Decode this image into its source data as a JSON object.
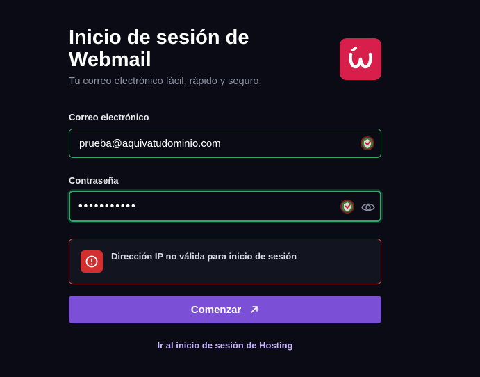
{
  "header": {
    "title": "Inicio de sesión de Webmail",
    "subtitle": "Tu correo electrónico fácil, rápido y seguro."
  },
  "email": {
    "label": "Correo electrónico",
    "value": "prueba@aquivatudominio.com"
  },
  "password": {
    "label": "Contraseña",
    "value": "•••••••••••"
  },
  "alert": {
    "message": "Dirección IP no válida para inicio de sesión"
  },
  "submit": {
    "label": "Comenzar"
  },
  "hosting_link": {
    "label": "Ir al inicio de sesión de Hosting"
  },
  "colors": {
    "background": "#0a0b14",
    "brand": "#d81f4b",
    "primary": "#7b4fd6",
    "success_border": "#2ea86a",
    "error_border": "#d25b5b",
    "link": "#c9b3ff"
  },
  "icons": {
    "logo": "brand-w-logo-icon",
    "email_badge": "password-manager-icon",
    "password_badge": "password-manager-icon",
    "show_password": "eye-icon",
    "alert": "exclamation-circle-icon",
    "submit": "arrow-up-right-icon"
  }
}
